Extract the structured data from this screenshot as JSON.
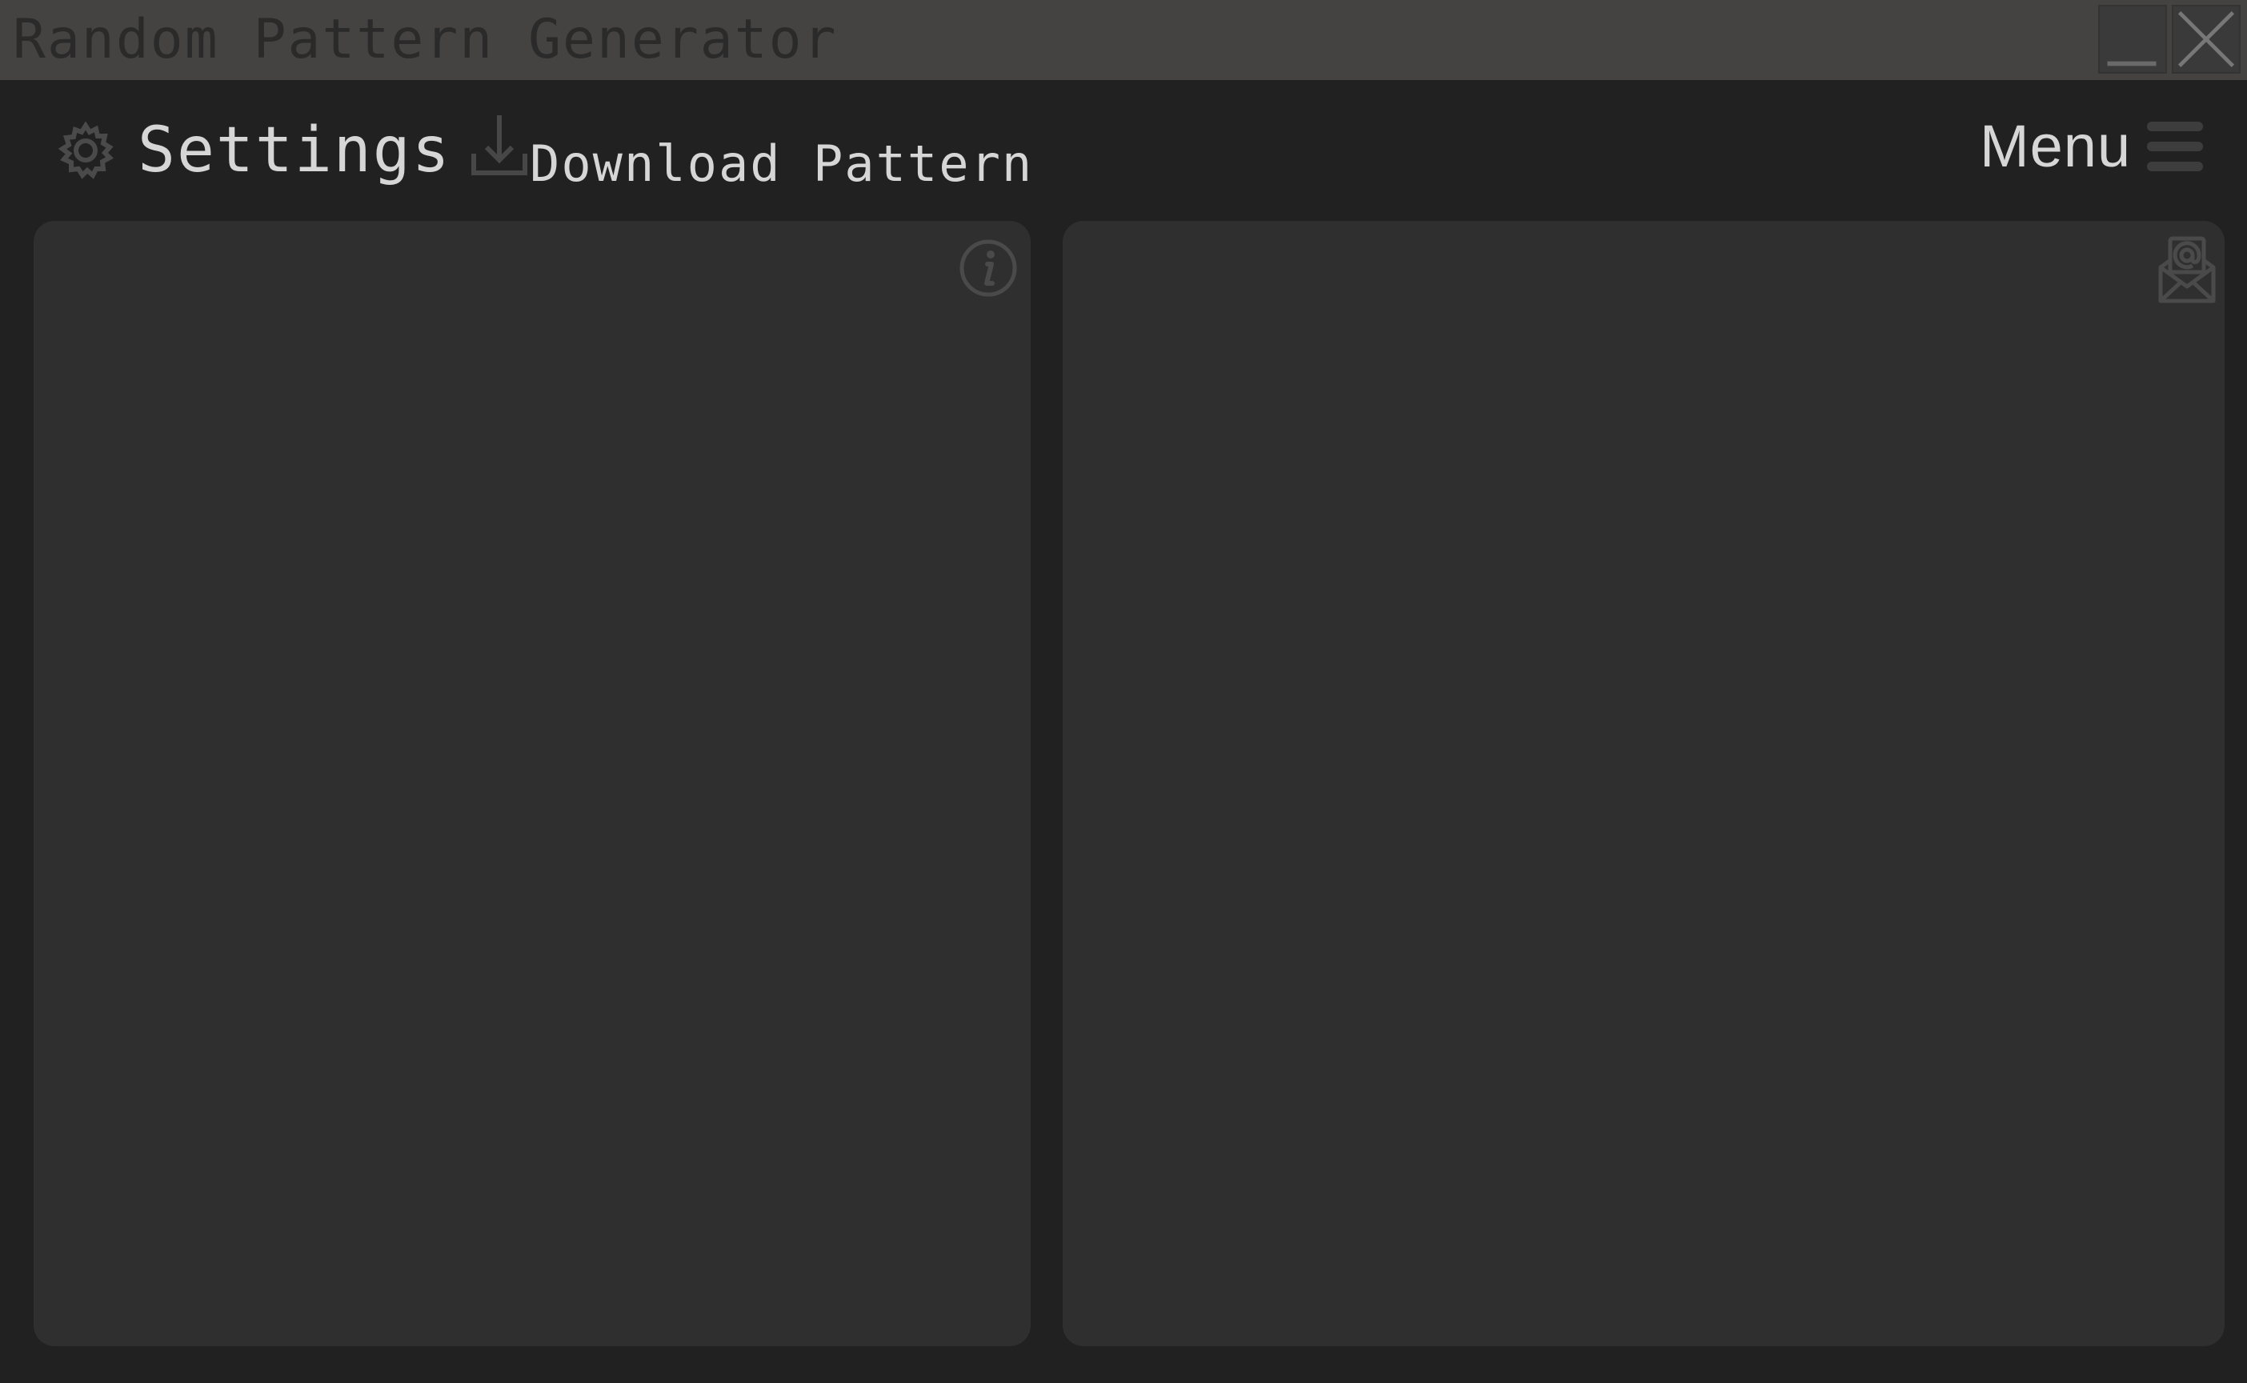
{
  "window": {
    "title": "Random Pattern Generator",
    "controls": {
      "minimize_icon": "minimize-icon",
      "close_icon": "close-icon"
    }
  },
  "toolbar": {
    "settings_label": "Settings",
    "settings_icon": "gear-icon",
    "download_label": "Download Pattern",
    "download_icon": "download-icon",
    "menu_label": "Menu",
    "menu_icon": "hamburger-icon"
  },
  "panels": {
    "left": {
      "icon": "info-icon"
    },
    "right": {
      "icon": "mail-icon"
    }
  },
  "colors": {
    "titlebar_bg": "#444342",
    "app_bg": "#212121",
    "panel_bg": "#302f30",
    "text": "#d6d6d6",
    "muted_icon": "#4a4a4a"
  }
}
